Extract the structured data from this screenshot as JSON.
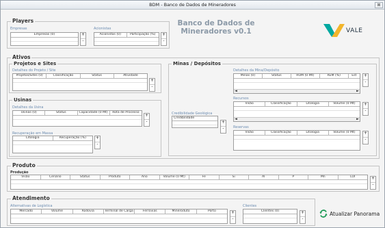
{
  "window": {
    "title": "BDM - Banco de Dados de Mineradores",
    "close": "⊠"
  },
  "brand": {
    "title_line1": "Banco de Dados de",
    "title_line2": "Mineradores v0.1",
    "logo_text": "VALE"
  },
  "players": {
    "label": "Players",
    "empresas": {
      "label": "Empresas",
      "columns": [
        "Empresas (0)"
      ]
    },
    "acionistas": {
      "label": "Acionistas",
      "columns": [
        "Acionistas (0)",
        "Participação (%)"
      ]
    }
  },
  "ativos": {
    "label": "Ativos",
    "projetos": {
      "label": "Projetos e Sites",
      "detalhes": {
        "label": "Detalhes do Projeto / Site",
        "columns": [
          "Projetos/Sites (0)",
          "Classificação",
          "Status",
          "Atividade"
        ]
      }
    },
    "usinas": {
      "label": "Usinas",
      "detalhes": {
        "label": "Detalhes da Usina",
        "columns": [
          "Usinas (0)",
          "Status",
          "Capacidade (0 Mt)",
          "Rota de Processo"
        ]
      },
      "recuperacao": {
        "label": "Recuperação em Massa",
        "columns": [
          "Litologia",
          "Recuperação (%)"
        ]
      }
    },
    "minas": {
      "label": "Minas / Depósitos",
      "credibilidade": {
        "label": "Credibilidade Geológica",
        "columns": [
          "Credibilidade"
        ]
      },
      "detalhes": {
        "label": "Detalhes da Mina/Depósito",
        "columns": [
          "Minas (0)",
          "Status",
          "ROM (0 Mt)",
          "REM (%)",
          "Est"
        ]
      },
      "recursos": {
        "label": "Recursos",
        "columns": [
          "Visão",
          "Classificação",
          "Litologia",
          "Volume (0 Mt)"
        ]
      },
      "reservas": {
        "label": "Reservas",
        "columns": [
          "Visão",
          "Classificação",
          "Litologia",
          "Volume (0 Mt)"
        ]
      }
    }
  },
  "produto": {
    "label": "Produto",
    "producao": {
      "label": "Produção",
      "columns": [
        "Visão",
        "Cenário",
        "Status",
        "Produto",
        "Ano",
        "Volume (0 Mt)",
        "Fe",
        "Si",
        "Al",
        "P",
        "Mn",
        "LOI"
      ]
    }
  },
  "atendimento": {
    "label": "Atendimento",
    "alternativas": {
      "label": "Alternativas de Logística",
      "columns": [
        "Mercado",
        "Volume",
        "Rodovia",
        "Terminal de Carga",
        "Ferrovias",
        "Mineroduto",
        "Porto"
      ]
    },
    "clientes": {
      "label": "Clientes",
      "columns": [
        "Clientes (0)"
      ]
    }
  },
  "controls": {
    "plus": "+",
    "minus": "-",
    "arrow_left": "◄",
    "arrow_right": "►",
    "refresh_label": "Atualizar Panorama"
  },
  "colors": {
    "accent_green": "#1e9b57",
    "vale_teal": "#00a8a0",
    "vale_yellow": "#f2b52b"
  }
}
